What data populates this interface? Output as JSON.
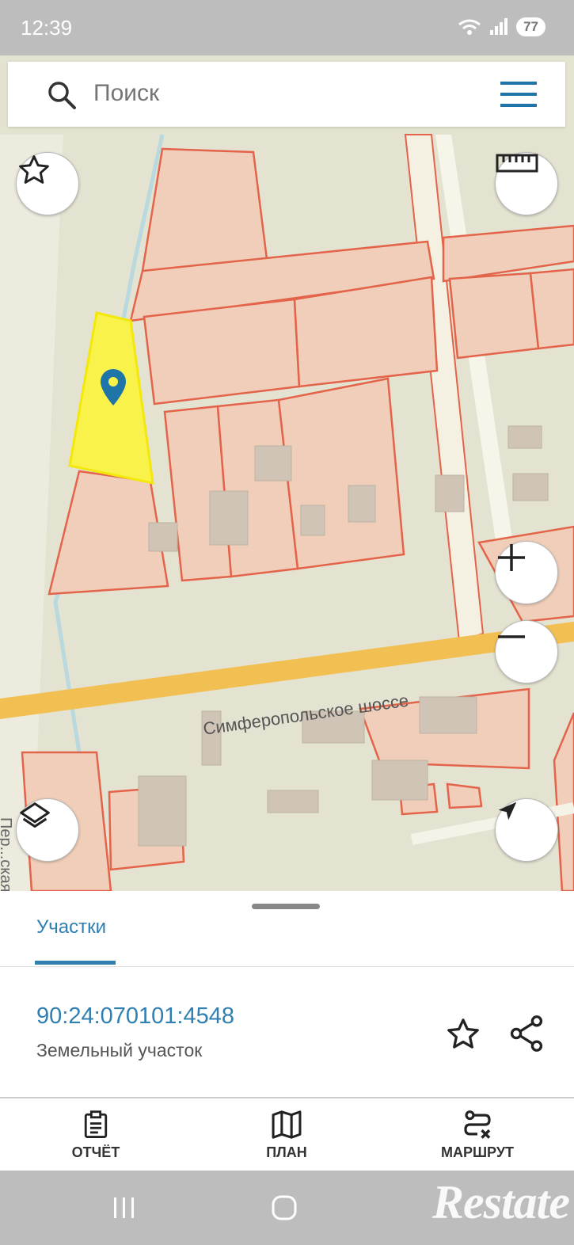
{
  "status": {
    "time": "12:39",
    "battery": "77"
  },
  "search": {
    "placeholder": "Поиск"
  },
  "map": {
    "road_label": "Симферопольское шоссе",
    "street_label": "Пер...ская"
  },
  "sheet": {
    "tab": "Участки",
    "parcel_id": "90:24:070101:4548",
    "parcel_type": "Земельный участок"
  },
  "nav": {
    "report": "ОТЧЁТ",
    "plan": "ПЛАН",
    "route": "МАРШРУТ"
  },
  "watermark": "Restate",
  "colors": {
    "accent": "#2f7fb1",
    "parcel_fill": "#f0ceb9",
    "parcel_stroke": "#e3644a",
    "selected": "#f8f24a",
    "road": "#f2c052"
  },
  "icons": [
    "search-icon",
    "menu-icon",
    "star-icon",
    "ruler-icon",
    "layers-icon",
    "zoom-in-icon",
    "zoom-out-icon",
    "locate-icon",
    "share-icon",
    "clipboard-icon",
    "map-icon",
    "route-icon"
  ]
}
